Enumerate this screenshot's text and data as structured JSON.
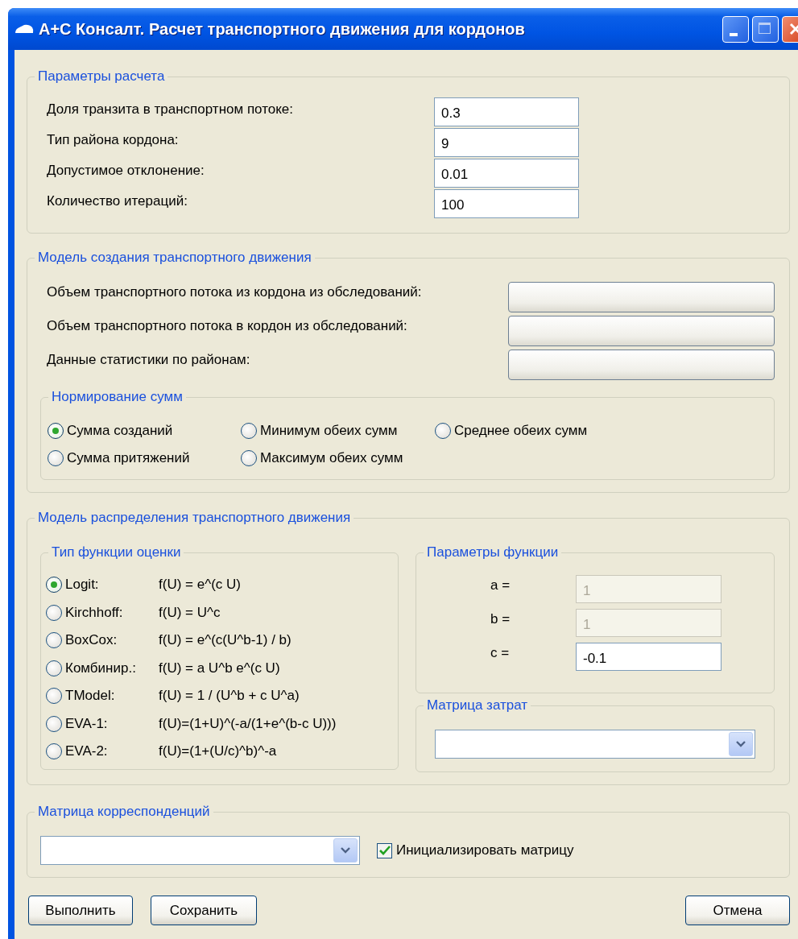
{
  "window": {
    "title": "A+C Консалт. Расчет транспортного движения для кордонов"
  },
  "parameters": {
    "title": "Параметры расчета",
    "rows": [
      {
        "label": "Доля транзита в транспортном потоке:",
        "value": "0.3"
      },
      {
        "label": "Тип района кордона:",
        "value": "9"
      },
      {
        "label": "Допустимое отклонение:",
        "value": "0.01"
      },
      {
        "label": "Количество итераций:",
        "value": "100"
      }
    ]
  },
  "generation": {
    "title": "Модель создания транспортного движения",
    "rows": [
      {
        "label": "Объем транспортного потока из кордона из обследований:"
      },
      {
        "label": "Объем транспортного потока в кордон из обследований:"
      },
      {
        "label": "Данные статистики по районам:"
      }
    ],
    "normalization": {
      "title": "Нормирование сумм",
      "options": [
        {
          "label": "Сумма созданий",
          "selected": true
        },
        {
          "label": "Сумма притяжений",
          "selected": false
        },
        {
          "label": "Минимум обеих сумм",
          "selected": false
        },
        {
          "label": "Максимум обеих сумм",
          "selected": false
        },
        {
          "label": "Среднее обеих сумм",
          "selected": false
        }
      ]
    }
  },
  "distribution": {
    "title": "Модель распределения транспортного движения",
    "function_type": {
      "title": "Тип функции оценки",
      "options": [
        {
          "label": "Logit:",
          "formula": "f(U) = e^(c U)",
          "selected": true
        },
        {
          "label": "Kirchhoff:",
          "formula": "f(U) = U^c",
          "selected": false
        },
        {
          "label": "BoxCox:",
          "formula": "f(U) = e^(c(U^b-1) / b)",
          "selected": false
        },
        {
          "label": "Комбинир.:",
          "formula": "f(U) = a U^b e^(c U)",
          "selected": false
        },
        {
          "label": "TModel:",
          "formula": "f(U) = 1 / (U^b + c U^a)",
          "selected": false
        },
        {
          "label": "EVA-1:",
          "formula": "f(U)=(1+U)^(-a/(1+e^(b-c U)))",
          "selected": false
        },
        {
          "label": "EVA-2:",
          "formula": "f(U)=(1+(U/c)^b)^-a",
          "selected": false
        }
      ]
    },
    "function_params": {
      "title": "Параметры функции",
      "rows": [
        {
          "label": "a =",
          "value": "1",
          "disabled": true
        },
        {
          "label": "b =",
          "value": "1",
          "disabled": true
        },
        {
          "label": "c =",
          "value": "-0.1",
          "disabled": false
        }
      ]
    },
    "cost_matrix": {
      "title": "Матрица затрат"
    }
  },
  "correspondence": {
    "title": "Матрица корреспонденций",
    "initialize": {
      "label": "Инициализировать матрицу",
      "checked": true
    }
  },
  "buttons": [
    {
      "label": "Выполнить",
      "kind": "left"
    },
    {
      "label": "Сохранить",
      "kind": "left"
    },
    {
      "label": "Отмена",
      "kind": "right"
    }
  ]
}
